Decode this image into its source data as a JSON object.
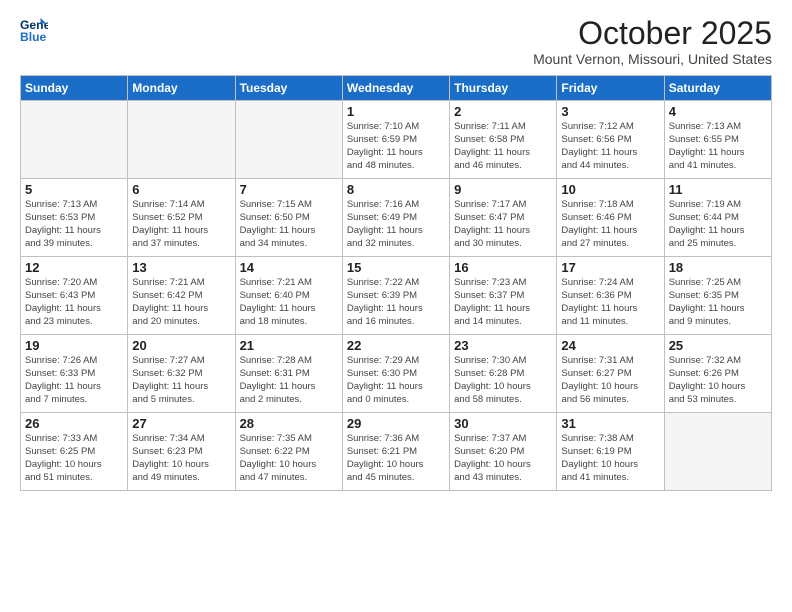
{
  "header": {
    "logo_line1": "General",
    "logo_line2": "Blue",
    "month": "October 2025",
    "location": "Mount Vernon, Missouri, United States"
  },
  "weekdays": [
    "Sunday",
    "Monday",
    "Tuesday",
    "Wednesday",
    "Thursday",
    "Friday",
    "Saturday"
  ],
  "weeks": [
    [
      {
        "day": "",
        "info": ""
      },
      {
        "day": "",
        "info": ""
      },
      {
        "day": "",
        "info": ""
      },
      {
        "day": "1",
        "info": "Sunrise: 7:10 AM\nSunset: 6:59 PM\nDaylight: 11 hours\nand 48 minutes."
      },
      {
        "day": "2",
        "info": "Sunrise: 7:11 AM\nSunset: 6:58 PM\nDaylight: 11 hours\nand 46 minutes."
      },
      {
        "day": "3",
        "info": "Sunrise: 7:12 AM\nSunset: 6:56 PM\nDaylight: 11 hours\nand 44 minutes."
      },
      {
        "day": "4",
        "info": "Sunrise: 7:13 AM\nSunset: 6:55 PM\nDaylight: 11 hours\nand 41 minutes."
      }
    ],
    [
      {
        "day": "5",
        "info": "Sunrise: 7:13 AM\nSunset: 6:53 PM\nDaylight: 11 hours\nand 39 minutes."
      },
      {
        "day": "6",
        "info": "Sunrise: 7:14 AM\nSunset: 6:52 PM\nDaylight: 11 hours\nand 37 minutes."
      },
      {
        "day": "7",
        "info": "Sunrise: 7:15 AM\nSunset: 6:50 PM\nDaylight: 11 hours\nand 34 minutes."
      },
      {
        "day": "8",
        "info": "Sunrise: 7:16 AM\nSunset: 6:49 PM\nDaylight: 11 hours\nand 32 minutes."
      },
      {
        "day": "9",
        "info": "Sunrise: 7:17 AM\nSunset: 6:47 PM\nDaylight: 11 hours\nand 30 minutes."
      },
      {
        "day": "10",
        "info": "Sunrise: 7:18 AM\nSunset: 6:46 PM\nDaylight: 11 hours\nand 27 minutes."
      },
      {
        "day": "11",
        "info": "Sunrise: 7:19 AM\nSunset: 6:44 PM\nDaylight: 11 hours\nand 25 minutes."
      }
    ],
    [
      {
        "day": "12",
        "info": "Sunrise: 7:20 AM\nSunset: 6:43 PM\nDaylight: 11 hours\nand 23 minutes."
      },
      {
        "day": "13",
        "info": "Sunrise: 7:21 AM\nSunset: 6:42 PM\nDaylight: 11 hours\nand 20 minutes."
      },
      {
        "day": "14",
        "info": "Sunrise: 7:21 AM\nSunset: 6:40 PM\nDaylight: 11 hours\nand 18 minutes."
      },
      {
        "day": "15",
        "info": "Sunrise: 7:22 AM\nSunset: 6:39 PM\nDaylight: 11 hours\nand 16 minutes."
      },
      {
        "day": "16",
        "info": "Sunrise: 7:23 AM\nSunset: 6:37 PM\nDaylight: 11 hours\nand 14 minutes."
      },
      {
        "day": "17",
        "info": "Sunrise: 7:24 AM\nSunset: 6:36 PM\nDaylight: 11 hours\nand 11 minutes."
      },
      {
        "day": "18",
        "info": "Sunrise: 7:25 AM\nSunset: 6:35 PM\nDaylight: 11 hours\nand 9 minutes."
      }
    ],
    [
      {
        "day": "19",
        "info": "Sunrise: 7:26 AM\nSunset: 6:33 PM\nDaylight: 11 hours\nand 7 minutes."
      },
      {
        "day": "20",
        "info": "Sunrise: 7:27 AM\nSunset: 6:32 PM\nDaylight: 11 hours\nand 5 minutes."
      },
      {
        "day": "21",
        "info": "Sunrise: 7:28 AM\nSunset: 6:31 PM\nDaylight: 11 hours\nand 2 minutes."
      },
      {
        "day": "22",
        "info": "Sunrise: 7:29 AM\nSunset: 6:30 PM\nDaylight: 11 hours\nand 0 minutes."
      },
      {
        "day": "23",
        "info": "Sunrise: 7:30 AM\nSunset: 6:28 PM\nDaylight: 10 hours\nand 58 minutes."
      },
      {
        "day": "24",
        "info": "Sunrise: 7:31 AM\nSunset: 6:27 PM\nDaylight: 10 hours\nand 56 minutes."
      },
      {
        "day": "25",
        "info": "Sunrise: 7:32 AM\nSunset: 6:26 PM\nDaylight: 10 hours\nand 53 minutes."
      }
    ],
    [
      {
        "day": "26",
        "info": "Sunrise: 7:33 AM\nSunset: 6:25 PM\nDaylight: 10 hours\nand 51 minutes."
      },
      {
        "day": "27",
        "info": "Sunrise: 7:34 AM\nSunset: 6:23 PM\nDaylight: 10 hours\nand 49 minutes."
      },
      {
        "day": "28",
        "info": "Sunrise: 7:35 AM\nSunset: 6:22 PM\nDaylight: 10 hours\nand 47 minutes."
      },
      {
        "day": "29",
        "info": "Sunrise: 7:36 AM\nSunset: 6:21 PM\nDaylight: 10 hours\nand 45 minutes."
      },
      {
        "day": "30",
        "info": "Sunrise: 7:37 AM\nSunset: 6:20 PM\nDaylight: 10 hours\nand 43 minutes."
      },
      {
        "day": "31",
        "info": "Sunrise: 7:38 AM\nSunset: 6:19 PM\nDaylight: 10 hours\nand 41 minutes."
      },
      {
        "day": "",
        "info": ""
      }
    ]
  ]
}
